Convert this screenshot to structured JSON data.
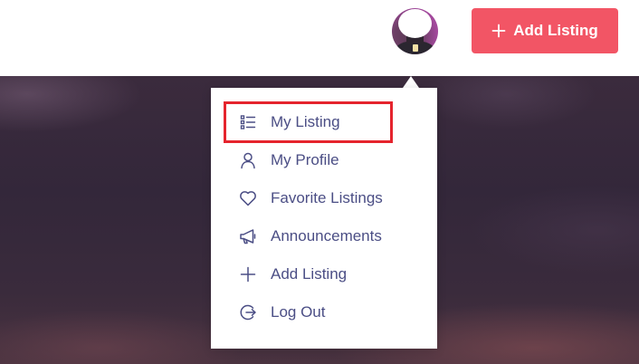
{
  "header": {
    "add_listing_label": "Add Listing"
  },
  "user_menu": {
    "items": [
      {
        "label": "My Listing",
        "icon": "list-icon"
      },
      {
        "label": "My Profile",
        "icon": "user-icon"
      },
      {
        "label": "Favorite Listings",
        "icon": "heart-icon"
      },
      {
        "label": "Announcements",
        "icon": "megaphone-icon"
      },
      {
        "label": "Add Listing",
        "icon": "plus-icon"
      },
      {
        "label": "Log Out",
        "icon": "logout-icon"
      }
    ],
    "highlighted_item": "My Listing"
  },
  "colors": {
    "accent": "#f25565",
    "menu_text": "#4b4e85",
    "highlight_border": "#e5242d"
  }
}
